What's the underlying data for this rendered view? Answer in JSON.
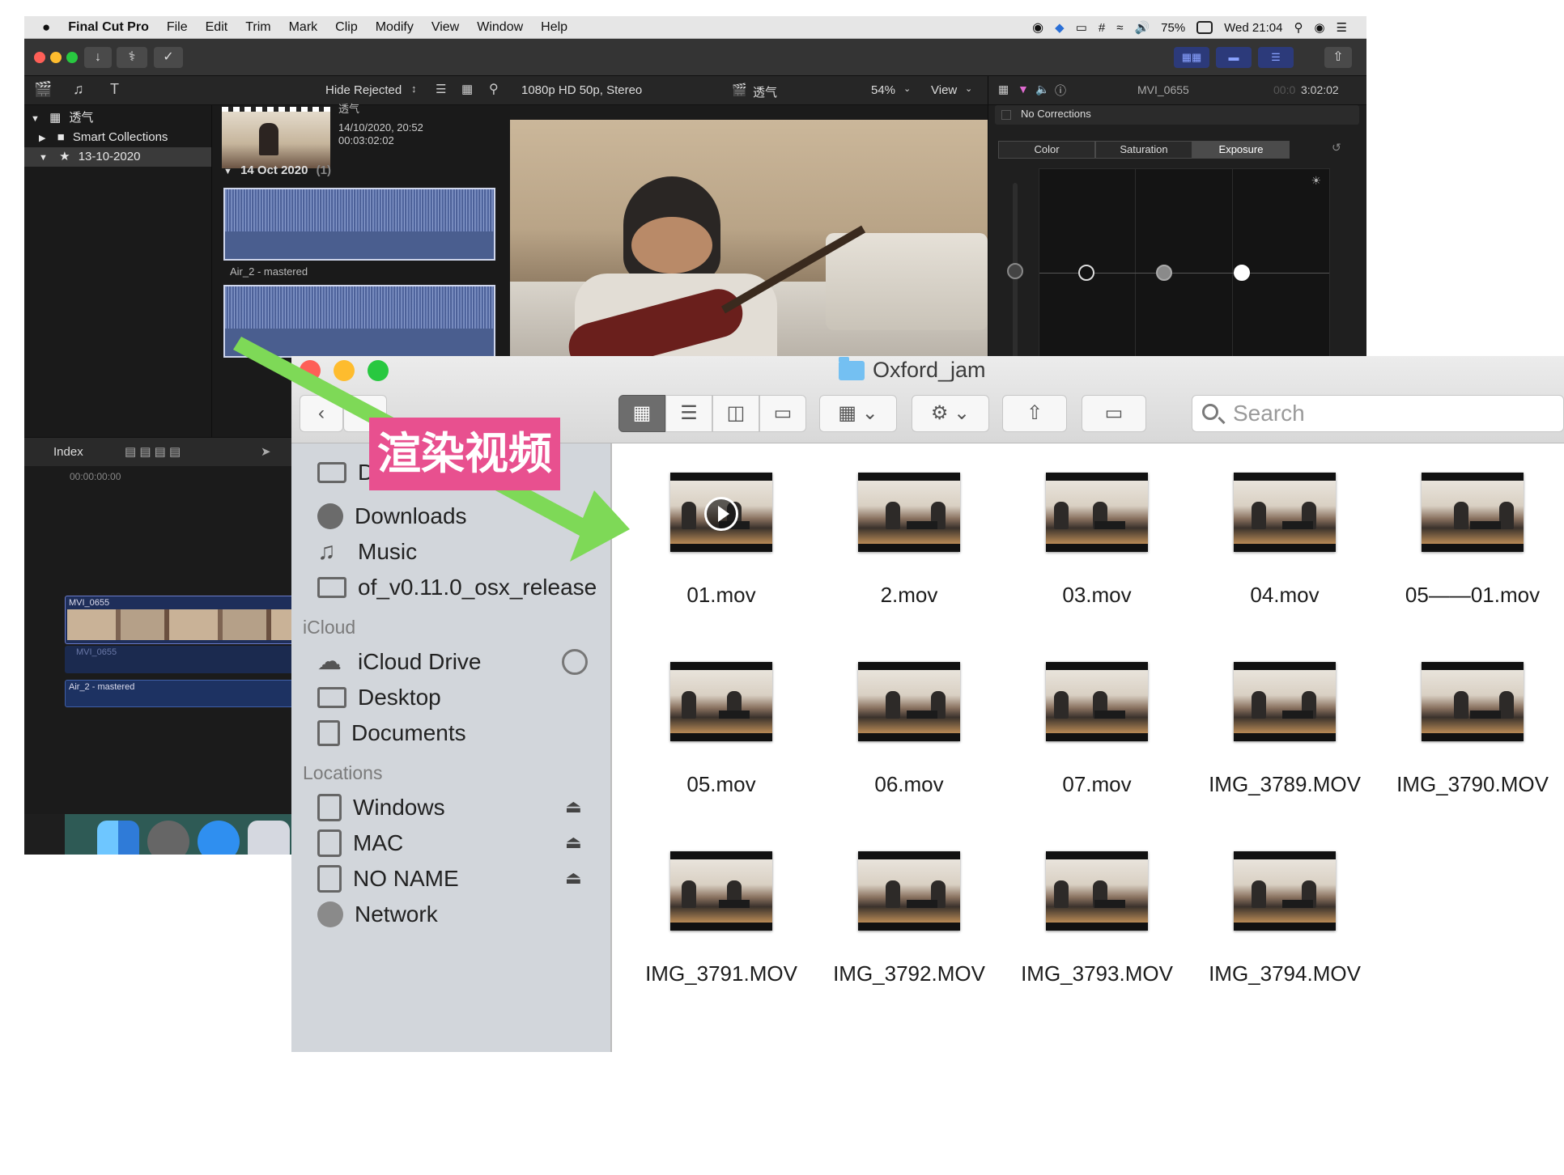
{
  "menubar": {
    "app": "Final Cut Pro",
    "items": [
      "File",
      "Edit",
      "Trim",
      "Mark",
      "Clip",
      "Modify",
      "View",
      "Window",
      "Help"
    ],
    "battery": "75%",
    "clock": "Wed 21:04"
  },
  "library": {
    "hide_rejected": "Hide Rejected",
    "root": "透气",
    "smart_collections": "Smart Collections",
    "event": "13-10-2020"
  },
  "browser": {
    "clip_top_label": "透气",
    "clip_date": "14/10/2020, 20:52",
    "clip_duration": "00:03:02:02",
    "group_header": "14 Oct 2020",
    "group_count": "(1)",
    "clip1_name": "Air_2 - mastered"
  },
  "viewer": {
    "format": "1080p HD 50p, Stereo",
    "project": "透气",
    "zoom": "54%",
    "view": "View"
  },
  "inspector": {
    "clip_name": "MVI_0655",
    "timecode_dim": "00:0",
    "timecode": "3:02:02",
    "corrections": "No Corrections",
    "tabs": [
      "Color",
      "Saturation",
      "Exposure"
    ],
    "active_tab": "Exposure"
  },
  "timeline": {
    "index": "Index",
    "timecode": "00:00:00:00",
    "clip_video": "MVI_0655",
    "clip_audio": "MVI_0655",
    "clip_music": "Air_2 - mastered"
  },
  "finder": {
    "title": "Oxford_jam",
    "search_placeholder": "Search",
    "sidebar": {
      "partial_item": "D",
      "favorites": [
        "Downloads",
        "Music",
        "of_v0.11.0_osx_release"
      ],
      "icloud_header": "iCloud",
      "icloud": [
        "iCloud Drive",
        "Desktop",
        "Documents"
      ],
      "locations_header": "Locations",
      "locations": [
        "Windows",
        "MAC",
        "NO NAME",
        "Network"
      ]
    },
    "files": [
      "01.mov",
      "2.mov",
      "03.mov",
      "04.mov",
      "05——01.mov",
      "05.mov",
      "06.mov",
      "07.mov",
      "IMG_3789.MOV",
      "IMG_3790.MOV",
      "IMG_3791.MOV",
      "IMG_3792.MOV",
      "IMG_3793.MOV",
      "IMG_3794.MOV"
    ]
  },
  "annotation": {
    "label": "渲染视频",
    "color": "#e8508f",
    "arrow_color": "#7ed957"
  }
}
